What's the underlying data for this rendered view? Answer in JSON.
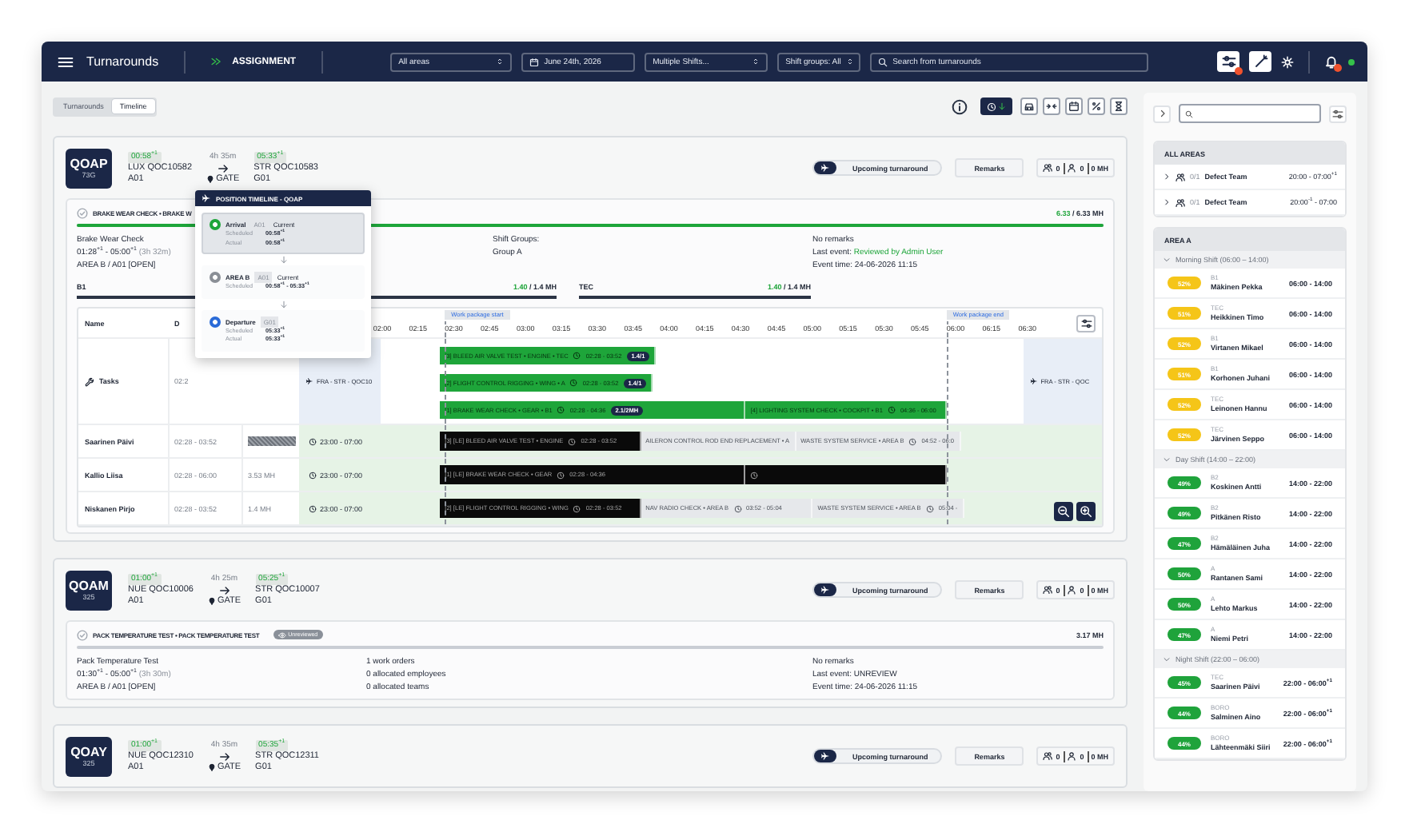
{
  "topbar": {
    "title": "Turnarounds",
    "module": "ASSIGNMENT",
    "filters": [
      {
        "kind": "select",
        "value": "All areas"
      },
      {
        "kind": "date",
        "value": "June 24th, 2026"
      },
      {
        "kind": "select",
        "value": "Multiple Shifts..."
      },
      {
        "kind": "select",
        "value": "Shift groups: All"
      },
      {
        "kind": "search",
        "placeholder": "Search from turnarounds"
      }
    ]
  },
  "view_toggle": [
    {
      "label": "Turnarounds",
      "selected": false
    },
    {
      "label": "Timeline",
      "selected": true
    }
  ],
  "turnarounds": [
    {
      "registration": "QOAP",
      "aircraft_type": "73G",
      "arrival": {
        "time": "00:58$^{+1}$",
        "flight": "LUX QOC10582",
        "stand": "A01"
      },
      "duration": "4h 35m",
      "position": "GATE",
      "departure": {
        "time": "05:33$^{+1}$",
        "flight": "STR QOC10583",
        "stand": "G01"
      },
      "status": "Upcoming turnaround",
      "remarks_button": "Remarks",
      "staff": {
        "teams": "0",
        "people": "0",
        "hours": "0 MH"
      },
      "work_package": {
        "title": "BRAKE WEAR CHECK • BRAKE W",
        "mh_done": "6.33",
        "mh_total": "/ 6.33 MH",
        "level": 1,
        "name": "Brake Wear Check",
        "time": "01:28$^{+1}$ - 05:00$^{+1}$",
        "time_span": "(3h 32m)",
        "location": "AREA B / A01 [OPEN]",
        "shift_groups": [
          "Shift Groups:",
          "Group A"
        ],
        "remarks": "No remarks",
        "last_event": {
          "label": "Last event:",
          "value": "Reviewed by Admin User",
          "reviewed": true
        },
        "event_time": "Event time: 24-06-2026 11:15",
        "skills": [
          {
            "name": "B1",
            "done": "1.40",
            "total": "/ 1.4 MH",
            "level": 1
          },
          {
            "name": "TEC",
            "done": "1.40",
            "total": "/ 1.4 MH",
            "level": 1
          }
        ],
        "gantt": {
          "columns": [
            "Name",
            "D"
          ],
          "markers": [
            "Work package start",
            "Work package end"
          ],
          "ticks": [
            "02:00",
            "02:15",
            "02:30",
            "02:45",
            "03:00",
            "03:15",
            "03:30",
            "03:45",
            "04:00",
            "04:15",
            "04:30",
            "04:45",
            "05:00",
            "05:15",
            "05:30",
            "05:45",
            "06:00",
            "06:15",
            "06:30"
          ],
          "task_row": {
            "label": "Tasks",
            "dates": "02:2",
            "blocks": [
              "FRA - STR - QOC10",
              "FRA - STR - QOC"
            ],
            "lanes": [
              [
                {
                  "kind": "task",
                  "title": "[3] BLEED AIR VALVE TEST • ENGINE • TEC",
                  "time": "02:28 - 03:52",
                  "badge": "1.4/1"
                }
              ],
              [
                {
                  "kind": "task",
                  "title": "[2] FLIGHT CONTROL RIGGING • WING • A",
                  "time": "02:28 - 03:52",
                  "badge": "1.4/1"
                }
              ],
              [
                {
                  "kind": "task",
                  "title": "[1] BRAKE WEAR CHECK • GEAR • B1",
                  "time": "02:28 - 04:36",
                  "badge": "2.1/2MH"
                },
                {
                  "kind": "task",
                  "title": "[4] LIGHTING SYSTEM CHECK • COCKPIT • B1",
                  "time": "04:36 - 06:00"
                }
              ]
            ]
          },
          "employees": [
            {
              "name": "Saarinen Päivi",
              "dates": "02:28 - 03:52",
              "overbooked": true,
              "shift": "23:00 - 07:00",
              "bars": [
                {
                  "kind": "assigned",
                  "title": "[3] [LE] BLEED AIR VALVE TEST • ENGINE",
                  "time": "02:28 - 03:52"
                },
                {
                  "kind": "other",
                  "title": "AILERON CONTROL ROD END REPLACEMENT • A"
                },
                {
                  "kind": "other",
                  "title": "WASTE SYSTEM SERVICE • AREA B",
                  "time": "04:52 - 06:0"
                }
              ]
            },
            {
              "name": "Kallio Liisa",
              "dates": "02:28 - 06:00",
              "hours": "3.53 MH",
              "overbooked": false,
              "shift": "23:00 - 07:00",
              "bars": [
                {
                  "kind": "assigned",
                  "title": "[1] [LE] BRAKE WEAR CHECK • GEAR",
                  "time": "02:28 - 04:36"
                },
                {
                  "kind": "assigned"
                }
              ]
            },
            {
              "name": "Niskanen Pirjo",
              "dates": "02:28 - 03:52",
              "hours": "1.4 MH",
              "overbooked": false,
              "shift": "23:00 - 07:00",
              "bars": [
                {
                  "kind": "assigned",
                  "title": "[2] [LE] FLIGHT CONTROL RIGGING • WING",
                  "time": "02:28 - 03:52"
                },
                {
                  "kind": "other",
                  "title": "NAV RADIO CHECK • AREA B",
                  "time": "03:52 - 05:04"
                },
                {
                  "kind": "other",
                  "title": "WASTE SYSTEM SERVICE • AREA B",
                  "time": "05:04 -"
                }
              ]
            }
          ]
        }
      },
      "position_timeline": {
        "title": "POSITION TIMELINE - QOAP",
        "steps": [
          {
            "kind": "arrival",
            "name": "Arrival",
            "stand": "A01",
            "tag": "Current",
            "selected": true,
            "times": [
              {
                "label": "Scheduled",
                "value": "00:58$^{+1}$"
              },
              {
                "label": "Actual",
                "value": "00:58$^{+1}$"
              }
            ]
          },
          {
            "kind": "area",
            "name": "AREA B",
            "stand": "A01",
            "tag": "Current",
            "selected": false,
            "times": [
              {
                "label": "Scheduled",
                "value": "00:58$^{+1}$ - 05:33$^{+1}$"
              }
            ]
          },
          {
            "kind": "departure",
            "name": "Departure",
            "stand": "G01",
            "selected": false,
            "times": [
              {
                "label": "Scheduled",
                "value": "05:33$^{+1}$"
              },
              {
                "label": "Actual",
                "value": "05:33$^{+1}$"
              }
            ]
          }
        ]
      }
    },
    {
      "registration": "QOAM",
      "aircraft_type": "325",
      "arrival": {
        "time": "01:00$^{+1}$",
        "flight": "NUE QOC10006",
        "stand": "A01"
      },
      "duration": "4h 25m",
      "position": "GATE",
      "departure": {
        "time": "05:25$^{+1}$",
        "flight": "STR QOC10007",
        "stand": "G01"
      },
      "status": "Upcoming turnaround",
      "remarks_button": "Remarks",
      "staff": {
        "teams": "0",
        "people": "0",
        "hours": "0 MH"
      },
      "work_package": {
        "title": "PACK TEMPERATURE TEST • PACK TEMPERATURE TEST",
        "status_badge": "Unreviewed",
        "mh_total": "3.17 MH",
        "level": 0,
        "name": "Pack Temperature Test",
        "time": "01:30$^{+1}$ - 05:00$^{+1}$",
        "time_span": "(3h 30m)",
        "location": "AREA B / A01 [OPEN]",
        "allocation": [
          "1 work orders",
          "0 allocated employees",
          "0 allocated teams"
        ],
        "remarks": "No remarks",
        "last_event": {
          "label": "Last event:",
          "value": "UNREVIEW",
          "reviewed": false
        },
        "event_time": "Event time: 24-06-2026 11:15"
      }
    },
    {
      "registration": "QOAY",
      "aircraft_type": "325",
      "arrival": {
        "time": "01:00$^{+1}$",
        "flight": "NUE QOC12310",
        "stand": "A01"
      },
      "duration": "4h 35m",
      "position": "GATE",
      "departure": {
        "time": "05:35$^{+1}$",
        "flight": "STR QOC12311",
        "stand": "G01"
      },
      "status": "Upcoming turnaround",
      "remarks_button": "Remarks",
      "staff": {
        "teams": "0",
        "people": "0",
        "hours": "0 MH"
      }
    }
  ],
  "sidebar": {
    "sections": [
      {
        "title": "ALL AREAS",
        "teams": [
          {
            "count": "0/1",
            "name": "Defect Team",
            "time": "20:00 - 07:00$^{+1}$"
          },
          {
            "count": "0/1",
            "name": "Defect Team",
            "time": "20:00$^{-1}$ - 07:00"
          }
        ]
      },
      {
        "title": "AREA A",
        "shifts": [
          {
            "label": "Morning Shift (06:00 – 14:00)",
            "expanded": true,
            "people": [
              {
                "load": "52%",
                "color": "#f5c518",
                "role": "B1",
                "name": "Mäkinen Pekka",
                "time": "06:00 - 14:00"
              },
              {
                "load": "51%",
                "color": "#f5c518",
                "role": "TEC",
                "name": "Heikkinen Timo",
                "time": "06:00 - 14:00"
              },
              {
                "load": "52%",
                "color": "#f5c518",
                "role": "B1",
                "name": "Virtanen Mikael",
                "time": "06:00 - 14:00"
              },
              {
                "load": "51%",
                "color": "#f5c518",
                "role": "B1",
                "name": "Korhonen Juhani",
                "time": "06:00 - 14:00"
              },
              {
                "load": "52%",
                "color": "#f5c518",
                "role": "TEC",
                "name": "Leinonen Hannu",
                "time": "06:00 - 14:00"
              },
              {
                "load": "52%",
                "color": "#f5c518",
                "role": "TEC",
                "name": "Järvinen Seppo",
                "time": "06:00 - 14:00"
              }
            ]
          },
          {
            "label": "Day Shift (14:00 – 22:00)",
            "expanded": true,
            "people": [
              {
                "load": "49%",
                "color": "#1fa33b",
                "role": "B2",
                "name": "Koskinen Antti",
                "time": "14:00 - 22:00"
              },
              {
                "load": "49%",
                "color": "#1fa33b",
                "role": "B2",
                "name": "Pitkänen Risto",
                "time": "14:00 - 22:00"
              },
              {
                "load": "47%",
                "color": "#1fa33b",
                "role": "B2",
                "name": "Hämäläinen Juha",
                "time": "14:00 - 22:00"
              },
              {
                "load": "50%",
                "color": "#1fa33b",
                "role": "A",
                "name": "Rantanen Sami",
                "time": "14:00 - 22:00"
              },
              {
                "load": "50%",
                "color": "#1fa33b",
                "role": "A",
                "name": "Lehto Markus",
                "time": "14:00 - 22:00"
              },
              {
                "load": "47%",
                "color": "#1fa33b",
                "role": "A",
                "name": "Niemi Petri",
                "time": "14:00 - 22:00"
              }
            ]
          },
          {
            "label": "Night Shift (22:00 – 06:00)",
            "expanded": true,
            "people": [
              {
                "load": "45%",
                "color": "#1fa33b",
                "role": "TEC",
                "name": "Saarinen Päivi",
                "time": "22:00 - 06:00$^{+1}$"
              },
              {
                "load": "44%",
                "color": "#1fa33b",
                "role": "BORO",
                "name": "Salminen Aino",
                "time": "22:00 - 06:00$^{+1}$"
              },
              {
                "load": "44%",
                "color": "#1fa33b",
                "role": "BORO",
                "name": "Lähteenmäki Siiri",
                "time": "22:00 - 06:00$^{+1}$"
              }
            ]
          }
        ]
      }
    ]
  }
}
